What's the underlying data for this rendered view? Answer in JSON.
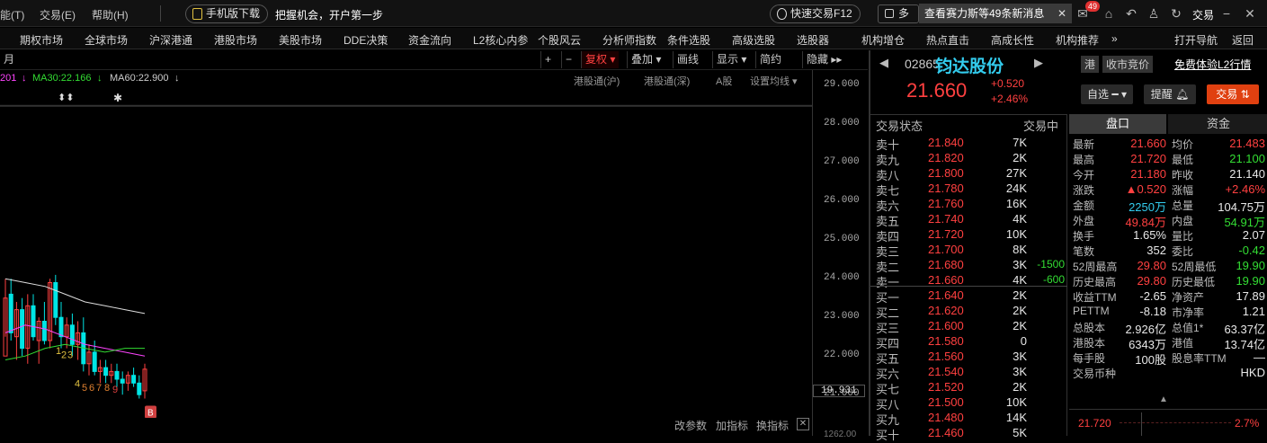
{
  "topbar": {
    "menu": [
      "能(T)",
      "交易(E)",
      "帮助(H)"
    ],
    "mobile_btn": "手机版下载",
    "slogan": "把握机会，开户第一步",
    "quick_trade": "快速交易F12",
    "multi": "多",
    "news": "查看赛力斯等49条新消息",
    "mail_badge": "49",
    "trade_btn": "交易"
  },
  "nav": [
    "期权市场",
    "全球市场",
    "沪深港通",
    "港股市场",
    "美股市场",
    "DDE决策",
    "资金流向",
    "L2核心内参",
    "个股风云",
    "分析师指数",
    "条件选股",
    "高级选股",
    "选股器",
    "机构增仓",
    "热点直击",
    "高成长性",
    "机构推荐",
    "»",
    "打开导航",
    "返回"
  ],
  "chart": {
    "period": "月",
    "tools": [
      "+",
      "−",
      "复权",
      "叠加",
      "画线",
      "显示",
      "简约",
      "隐藏"
    ],
    "ma_labels": [
      "201",
      "MA30:22.166",
      "MA60:22.900"
    ],
    "head_tabs": [
      "港股通(沪)",
      "港股通(深)",
      "A股",
      "设置均线"
    ],
    "bottom_tools": [
      "改参数",
      "加指标",
      "换指标"
    ],
    "current_price_label": "19.931",
    "bottom_axis_label": "1262.00",
    "seq_labels": [
      "1",
      "2",
      "3",
      "4",
      "5",
      "6",
      "7",
      "8",
      "9"
    ],
    "marker": "B",
    "colors": {
      "bull": "#ff4040",
      "bear": "#00e5e5",
      "ma5": "#ffffff",
      "ma10": "#e0c040",
      "ma20": "#ff44ff",
      "ma30": "#33dd33"
    }
  },
  "chart_data": {
    "type": "candlestick",
    "yticks": [
      29.0,
      28.0,
      27.0,
      26.0,
      25.0,
      24.0,
      23.0,
      22.0,
      21.0
    ],
    "ylim": [
      20.4,
      29.4
    ],
    "candles": [
      [
        22.0,
        24.0,
        22.5,
        23.5
      ],
      [
        23.6,
        24.0,
        22.4,
        22.6
      ],
      [
        22.5,
        23.4,
        21.9,
        23.2
      ],
      [
        23.2,
        23.5,
        22.0,
        22.2
      ],
      [
        22.2,
        23.6,
        21.8,
        23.3
      ],
      [
        23.3,
        23.6,
        22.4,
        22.5
      ],
      [
        22.4,
        23.0,
        21.8,
        22.9
      ],
      [
        22.9,
        23.4,
        22.3,
        22.4
      ],
      [
        22.4,
        24.0,
        22.2,
        23.9
      ],
      [
        23.9,
        24.1,
        22.8,
        23.0
      ],
      [
        23.0,
        23.4,
        22.2,
        22.5
      ],
      [
        22.5,
        23.0,
        22.2,
        22.8
      ],
      [
        22.8,
        23.1,
        22.0,
        22.3
      ],
      [
        22.3,
        22.9,
        21.9,
        22.6
      ],
      [
        22.6,
        23.0,
        21.6,
        21.8
      ],
      [
        21.8,
        22.3,
        21.5,
        22.1
      ],
      [
        22.1,
        22.4,
        21.5,
        21.6
      ],
      [
        21.6,
        21.9,
        21.3,
        21.7
      ],
      [
        21.7,
        21.9,
        21.3,
        21.5
      ],
      [
        21.5,
        21.8,
        21.3,
        21.6
      ],
      [
        21.6,
        21.8,
        21.2,
        21.4
      ],
      [
        21.4,
        21.6,
        21.0,
        21.3
      ],
      [
        21.3,
        21.6,
        21.1,
        21.5
      ],
      [
        21.5,
        21.7,
        21.2,
        21.3
      ],
      [
        21.3,
        21.5,
        20.9,
        21.0
      ],
      [
        21.1,
        21.8,
        20.9,
        21.66
      ]
    ],
    "ma_upper": [
      24.0,
      23.9,
      23.8,
      23.6,
      23.4,
      23.3,
      23.2,
      23.1
    ],
    "ma_mid": [
      22.6,
      22.8,
      22.7,
      22.5,
      22.3,
      22.2,
      22.1,
      22.0
    ],
    "ma_low": [
      21.9,
      22.0,
      22.2,
      22.3,
      22.2,
      22.1,
      22.2,
      22.2
    ]
  },
  "stock": {
    "code": "02865",
    "name": "钧达股份",
    "price": "21.660",
    "change": "+0.520",
    "pct": "+2.46%",
    "tag_hk": "港",
    "tag_auction": "收市竞价",
    "l2": "免费体验L2行情",
    "btn_watch": "自选",
    "btn_alert": "提醒",
    "btn_trade": "交易"
  },
  "orderbook": {
    "header_left": "交易状态",
    "header_right": "交易中",
    "asks": [
      {
        "label": "卖十",
        "price": "21.840",
        "vol": "7K",
        "chg": ""
      },
      {
        "label": "卖九",
        "price": "21.820",
        "vol": "2K",
        "chg": ""
      },
      {
        "label": "卖八",
        "price": "21.800",
        "vol": "27K",
        "chg": ""
      },
      {
        "label": "卖七",
        "price": "21.780",
        "vol": "24K",
        "chg": ""
      },
      {
        "label": "卖六",
        "price": "21.760",
        "vol": "16K",
        "chg": ""
      },
      {
        "label": "卖五",
        "price": "21.740",
        "vol": "4K",
        "chg": ""
      },
      {
        "label": "卖四",
        "price": "21.720",
        "vol": "10K",
        "chg": ""
      },
      {
        "label": "卖三",
        "price": "21.700",
        "vol": "8K",
        "chg": ""
      },
      {
        "label": "卖二",
        "price": "21.680",
        "vol": "3K",
        "chg": "-1500"
      },
      {
        "label": "卖一",
        "price": "21.660",
        "vol": "4K",
        "chg": "-600"
      }
    ],
    "bids": [
      {
        "label": "买一",
        "price": "21.640",
        "vol": "2K"
      },
      {
        "label": "买二",
        "price": "21.620",
        "vol": "2K"
      },
      {
        "label": "买三",
        "price": "21.600",
        "vol": "2K"
      },
      {
        "label": "买四",
        "price": "21.580",
        "vol": "0"
      },
      {
        "label": "买五",
        "price": "21.560",
        "vol": "3K"
      },
      {
        "label": "买六",
        "price": "21.540",
        "vol": "3K"
      },
      {
        "label": "买七",
        "price": "21.520",
        "vol": "2K"
      },
      {
        "label": "买八",
        "price": "21.500",
        "vol": "10K"
      },
      {
        "label": "买九",
        "price": "21.480",
        "vol": "14K"
      },
      {
        "label": "买十",
        "price": "21.460",
        "vol": "5K"
      }
    ]
  },
  "stats": {
    "tabs": [
      "盘口",
      "资金"
    ],
    "rows": [
      [
        "最新",
        "21.660",
        "up",
        "均价",
        "21.483",
        "up"
      ],
      [
        "最高",
        "21.720",
        "up",
        "最低",
        "21.100",
        "dn"
      ],
      [
        "今开",
        "21.180",
        "up",
        "昨收",
        "21.140",
        "wht"
      ],
      [
        "涨跌",
        "▲0.520",
        "up",
        "涨幅",
        "+2.46%",
        "up"
      ],
      [
        "金额",
        "2250万",
        "cy",
        "总量",
        "104.75万",
        "wht"
      ],
      [
        "外盘",
        "49.84万",
        "up",
        "内盘",
        "54.91万",
        "dn"
      ],
      [
        "换手",
        "1.65%",
        "wht",
        "量比",
        "2.07",
        "wht"
      ],
      [
        "笔数",
        "352",
        "wht",
        "委比",
        "-0.42",
        "dn"
      ],
      [
        "52周最高",
        "29.80",
        "up",
        "52周最低",
        "19.90",
        "dn"
      ],
      [
        "历史最高",
        "29.80",
        "up",
        "历史最低",
        "19.90",
        "dn"
      ],
      [
        "收益TTM",
        "-2.65",
        "wht",
        "净资产",
        "17.89",
        "wht"
      ],
      [
        "PETTM",
        "-8.18",
        "wht",
        "市净率",
        "1.21",
        "wht"
      ],
      [
        "总股本",
        "2.926亿",
        "wht",
        "总值1*",
        "63.37亿",
        "wht"
      ],
      [
        "港股本",
        "6343万",
        "wht",
        "港值",
        "13.74亿",
        "wht"
      ],
      [
        "每手股",
        "100股",
        "wht",
        "股息率TTM",
        "—",
        "wht"
      ],
      [
        "交易币种",
        "",
        "wht",
        "",
        "HKD",
        "wht"
      ]
    ],
    "mini_price": "21.720",
    "mini_pct": "2.7%"
  }
}
